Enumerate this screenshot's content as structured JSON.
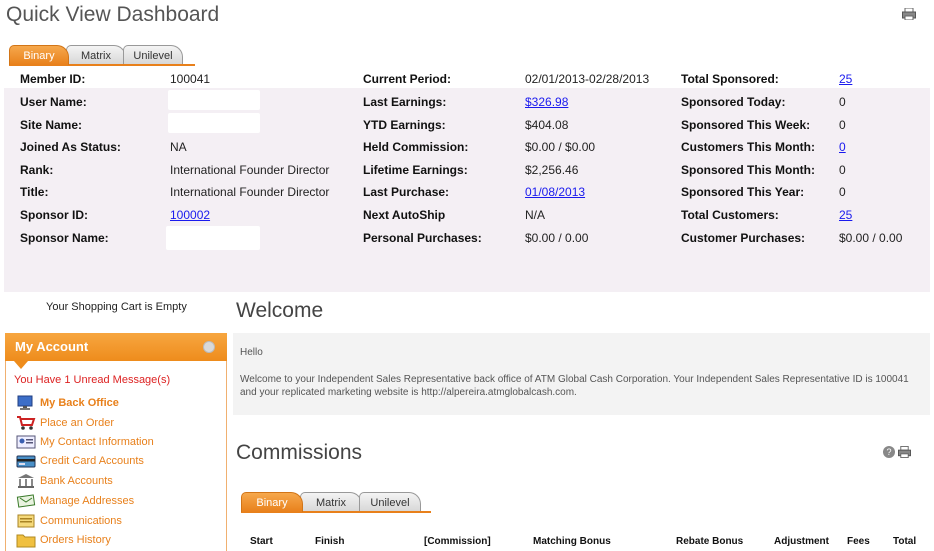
{
  "page": {
    "title": "Quick View Dashboard"
  },
  "top_tabs": [
    {
      "label": "Binary",
      "active": true
    },
    {
      "label": "Matrix",
      "active": false
    },
    {
      "label": "Unilevel",
      "active": false
    }
  ],
  "member_info": {
    "col1": [
      {
        "label": "Member ID:",
        "value": "100041",
        "link": false
      },
      {
        "label": "User Name:",
        "value": "",
        "link": false
      },
      {
        "label": "Site Name:",
        "value": "",
        "link": false
      },
      {
        "label": "Joined As Status:",
        "value": "NA",
        "link": false
      },
      {
        "label": "Rank:",
        "value": "International Founder Director",
        "link": false
      },
      {
        "label": "Title:",
        "value": "International Founder Director",
        "link": false
      },
      {
        "label": "Sponsor ID:",
        "value": "100002",
        "link": true
      },
      {
        "label": "Sponsor Name:",
        "value": "",
        "link": false
      }
    ],
    "col2": [
      {
        "label": "Current Period:",
        "value": "02/01/2013-02/28/2013",
        "link": false
      },
      {
        "label": "Last Earnings:",
        "value": "$326.98",
        "link": true
      },
      {
        "label": "YTD Earnings:",
        "value": "$404.08",
        "link": false
      },
      {
        "label": "Held Commission:",
        "value": "$0.00 / $0.00",
        "link": false
      },
      {
        "label": "Lifetime Earnings:",
        "value": "$2,256.46",
        "link": false
      },
      {
        "label": "Last Purchase:",
        "value": "01/08/2013",
        "link": true
      },
      {
        "label": "Next AutoShip",
        "value": "N/A",
        "link": false
      },
      {
        "label": "Personal Purchases:",
        "value": "$0.00 / 0.00",
        "link": false
      }
    ],
    "col3": [
      {
        "label": "Total Sponsored:",
        "value": "25",
        "link": true
      },
      {
        "label": "Sponsored Today:",
        "value": "0",
        "link": false
      },
      {
        "label": "Sponsored This Week:",
        "value": "0",
        "link": false
      },
      {
        "label": "Customers This Month:",
        "value": "0",
        "link": true
      },
      {
        "label": "Sponsored This Month:",
        "value": "0",
        "link": false
      },
      {
        "label": "Sponsored This Year:",
        "value": "0",
        "link": false
      },
      {
        "label": "Total Customers:",
        "value": "25",
        "link": true
      },
      {
        "label": "Customer Purchases:",
        "value": "$0.00 / 0.00",
        "link": false
      }
    ]
  },
  "sidebar": {
    "cart_text": "Your Shopping Cart is Empty",
    "account_title": "My Account",
    "unread_message": "You Have 1 Unread Message(s)",
    "items": [
      {
        "label": "My Back Office",
        "icon": "monitor-icon"
      },
      {
        "label": "Place an Order",
        "icon": "cart-icon"
      },
      {
        "label": "My Contact Information",
        "icon": "contact-card-icon"
      },
      {
        "label": "Credit Card Accounts",
        "icon": "credit-card-icon"
      },
      {
        "label": "Bank Accounts",
        "icon": "bank-icon"
      },
      {
        "label": "Manage Addresses",
        "icon": "address-icon"
      },
      {
        "label": "Communications",
        "icon": "communications-icon"
      },
      {
        "label": "Orders History",
        "icon": "folder-icon"
      }
    ]
  },
  "welcome": {
    "title": "Welcome",
    "hello": "Hello",
    "text": "Welcome to your Independent Sales Representative back office of ATM Global Cash Corporation. Your Independent Sales Representative ID is 100041 and your replicated marketing website is http://alpereira.atmglobalcash.com."
  },
  "commissions": {
    "title": "Commissions",
    "tabs": [
      {
        "label": "Binary",
        "active": true
      },
      {
        "label": "Matrix",
        "active": false
      },
      {
        "label": "Unilevel",
        "active": false
      }
    ],
    "columns": [
      "Start",
      "Finish",
      "[Commission]",
      "Matching Bonus",
      "Rebate Bonus",
      "Adjustment",
      "Fees",
      "Total"
    ]
  },
  "colors": {
    "accent": "#e8801b",
    "link": "#1a1aee",
    "panel_bg": "#f4eff4",
    "alert": "#dd2222"
  }
}
